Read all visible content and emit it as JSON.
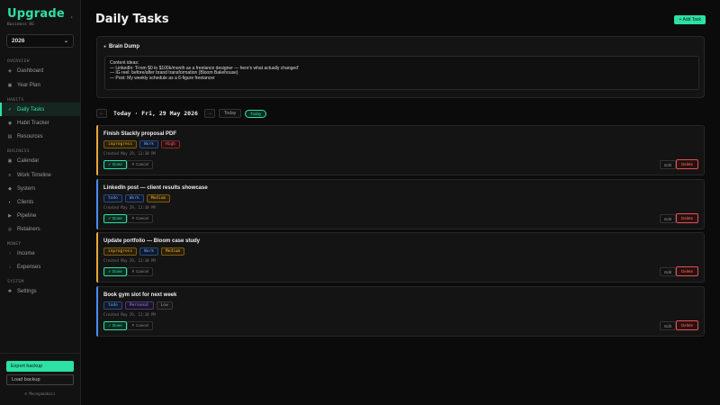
{
  "app": {
    "logo": "Upgrade",
    "subtitle": "Business OS",
    "year": "2026"
  },
  "sidebar": {
    "sections": [
      {
        "label": "OVERVIEW",
        "items": [
          {
            "label": "Dashboard",
            "icon": "grid-icon"
          },
          {
            "label": "Year Plan",
            "icon": "calendar-icon"
          }
        ]
      },
      {
        "label": "HABITS",
        "items": [
          {
            "label": "Daily Tasks",
            "icon": "check-icon",
            "active": true
          },
          {
            "label": "Habit Tracker",
            "icon": "target-icon"
          },
          {
            "label": "Resources",
            "icon": "book-icon"
          }
        ]
      },
      {
        "label": "BUSINESS",
        "items": [
          {
            "label": "Calendar",
            "icon": "calendar-icon"
          },
          {
            "label": "Work Timeline",
            "icon": "timeline-icon"
          },
          {
            "label": "System",
            "icon": "cog-icon"
          },
          {
            "label": "Clients",
            "icon": "users-icon"
          },
          {
            "label": "Pipeline",
            "icon": "pipeline-icon"
          },
          {
            "label": "Retainers",
            "icon": "retainer-icon"
          }
        ]
      },
      {
        "label": "MONEY",
        "items": [
          {
            "label": "Income",
            "icon": "arrow-up-icon"
          },
          {
            "label": "Expenses",
            "icon": "arrow-down-icon"
          }
        ]
      },
      {
        "label": "SYSTEM",
        "items": [
          {
            "label": "Settings",
            "icon": "gear-icon"
          }
        ]
      }
    ],
    "export_label": "Export backup",
    "load_label": "Load backup",
    "handle": "© Moongamakaiz"
  },
  "header": {
    "title": "Daily Tasks",
    "add_label": "+ Add Task"
  },
  "brain_dump": {
    "title": "Brain Dump",
    "lines": [
      "Content ideas:",
      "— LinkedIn: 'From $0 to $100k/month as a freelance designer — here's what actually changed'",
      "— IG reel: before/after brand transformation (Bloom Bakehouse)",
      "— Post: My weekly schedule as a 6-figure freelancer"
    ]
  },
  "datebar": {
    "prev": "←",
    "date": "Today · Fri, 29 May 2026",
    "next": "→",
    "today_btn": "Today",
    "today_badge": "Today"
  },
  "tasks": [
    {
      "title": "Finish Stackly proposal PDF",
      "status": "inprogress",
      "category": "Work",
      "priority": "High",
      "created": "Created May 29, 12:30 PM",
      "stripe": "#e9a93a"
    },
    {
      "title": "LinkedIn post — client results showcase",
      "status": "todo",
      "category": "Work",
      "priority": "Medium",
      "created": "Created May 29, 12:30 PM",
      "stripe": "#4a8ef0"
    },
    {
      "title": "Update portfolio — Bloom case study",
      "status": "inprogress",
      "category": "Work",
      "priority": "Medium",
      "created": "Created May 29, 12:30 PM",
      "stripe": "#e9a93a"
    },
    {
      "title": "Book gym slot for next week",
      "status": "todo",
      "category": "Personal",
      "priority": "Low",
      "created": "Created May 29, 12:30 PM",
      "stripe": "#4a8ef0"
    }
  ],
  "task_actions": {
    "done": "✓ Done",
    "cancel": "✕ Cancel",
    "edit": "Edit",
    "delete": "Delete"
  }
}
